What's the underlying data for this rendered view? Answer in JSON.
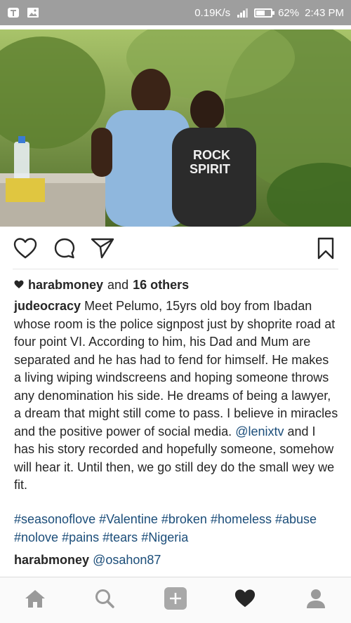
{
  "status_bar": {
    "network_speed": "0.19K/s",
    "battery_percent": "62%",
    "battery_level": 0.62,
    "time": "2:43 PM"
  },
  "post": {
    "image_alt_icon": "photo",
    "likes": {
      "user": "harabmoney",
      "conjunction": "and",
      "others": "16 others"
    },
    "caption": {
      "user": "judeocracy",
      "text_1": "Meet Pelumo, 15yrs old boy from Ibadan whose room is the police signpost just by shoprite road at four point VI. According to him, his Dad and Mum are separated and he has had to fend for himself. He makes a living wiping windscreens and hoping someone throws any denomination his side. He dreams of being a lawyer, a dream that might still come to pass. I believe in miracles and the positive power of social media.",
      "mention": "@lenixtv",
      "text_2": "and I has his story recorded and hopefully someone, somehow will hear it. Until then, we go still dey do the small wey we fit."
    },
    "hashtags": [
      "#seasonoflove",
      "#Valentine",
      "#broken",
      "#homeless",
      "#abuse",
      "#nolove",
      "#pains",
      "#tears",
      "#Nigeria"
    ],
    "comment": {
      "user": "harabmoney",
      "mention": "@osahon87"
    }
  },
  "icons": {
    "like": "heart-outline-icon",
    "comment": "speech-bubble-icon",
    "share": "paper-plane-icon",
    "save": "bookmark-icon",
    "nav": [
      "home-icon",
      "search-icon",
      "add-icon",
      "activity-heart-icon",
      "profile-icon"
    ]
  },
  "colors": {
    "status_bar": "#9e9e9e",
    "link": "#1b4d79",
    "text": "#262626"
  }
}
